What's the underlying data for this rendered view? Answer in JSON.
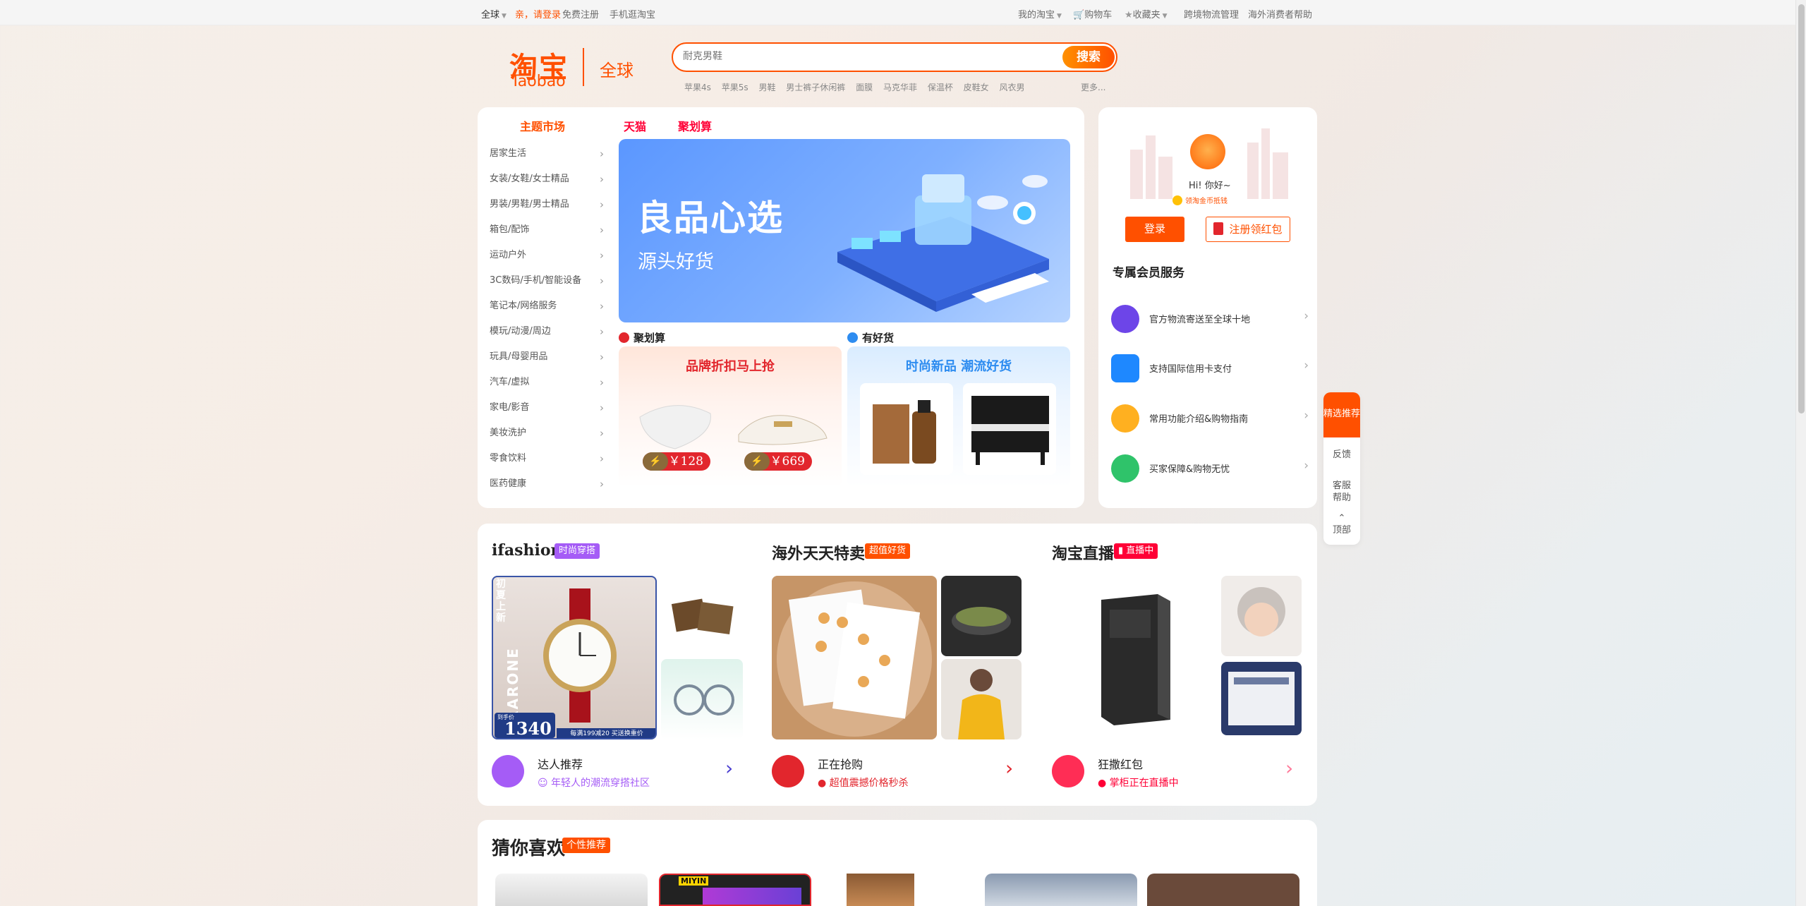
{
  "topbar": {
    "region": "全球",
    "greeting": "亲，请登录",
    "register": "免费注册",
    "mobile": "手机逛淘宝",
    "my_taobao": "我的淘宝",
    "cart": "购物车",
    "favorites": "收藏夹",
    "logistics": "跨境物流管理",
    "help": "海外消费者帮助"
  },
  "header": {
    "logo_cn": "淘宝",
    "logo_en": "Taobao",
    "site": "全球",
    "search_placeholder": "耐克男鞋",
    "search_button": "搜索",
    "hot_words": [
      "苹果4s",
      "苹果5s",
      "男鞋",
      "男士裤子休闲裤",
      "面膜",
      "马克华菲",
      "保温杯",
      "皮鞋女",
      "风衣男"
    ],
    "more": "更多..."
  },
  "main": {
    "tabs": [
      "主题市场",
      "天猫",
      "聚划算"
    ],
    "categories": [
      "居家生活",
      "女装/女鞋/女士精品",
      "男装/男鞋/男士精品",
      "箱包/配饰",
      "运动户外",
      "3C数码/手机/智能设备",
      "笔记本/网络服务",
      "模玩/动漫/周边",
      "玩具/母婴用品",
      "汽车/虚拟",
      "家电/影音",
      "美妆洗护",
      "零食饮料",
      "医药健康"
    ],
    "banner": {
      "title": "良品心选",
      "subtitle": "源头好货"
    },
    "juhuasuan": {
      "label": "聚划算",
      "title": "品牌折扣马上抢",
      "prices": [
        "￥128",
        "￥669"
      ]
    },
    "youhaohuo": {
      "label": "有好货",
      "title": "时尚新品 潮流好货"
    }
  },
  "member": {
    "greeting": "Hi! 你好~",
    "coin": "领淘金币抵钱",
    "login": "登录",
    "register": "注册领红包",
    "title": "专属会员服务",
    "services": [
      "官方物流寄送至全球十地",
      "支持国际信用卡支付",
      "常用功能介绍&购物指南",
      "买家保障&购物无忧"
    ]
  },
  "sidetool": {
    "top": "精选推荐",
    "items": [
      "反馈",
      "客服帮助",
      "顶部"
    ]
  },
  "modules": [
    {
      "title": "ifashion",
      "badge": "时尚穿搭",
      "foot_title": "达人推荐",
      "foot_sub": "年轻人的潮流穿搭社区",
      "tile_text": [
        "初夏上新",
        "RARONE",
        "1340",
        "到手价",
        "每满199减20 买送换重价"
      ]
    },
    {
      "title": "海外天天特卖",
      "badge": "超值好货",
      "foot_title": "正在抢购",
      "foot_sub": "超值震撼价格秒杀"
    },
    {
      "title": "淘宝直播",
      "badge": "直播中",
      "foot_title": "狂撒红包",
      "foot_sub": "掌柜正在直播中"
    }
  ],
  "guess": {
    "title": "猜你喜欢",
    "badge": "个性推荐",
    "brand": "MIYIN"
  },
  "colors": {
    "accent": "#ff5000",
    "tmall": "#ff0036",
    "ifashion_badge": "#a55cf6",
    "live_badge": "#ff0036"
  }
}
